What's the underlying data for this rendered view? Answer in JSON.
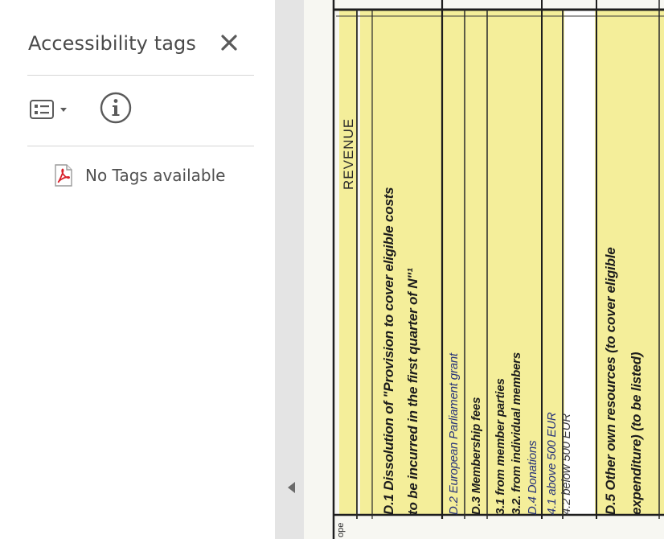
{
  "tags_panel": {
    "title": "Accessibility tags",
    "close_icon": "close-icon",
    "options_icon": "list-options-icon",
    "info_icon": "info-icon",
    "empty_message": "No Tags available",
    "empty_icon": "pdf-file-icon"
  },
  "splitter": {
    "collapse_icon": "triangle-left-icon"
  },
  "document": {
    "header": "REVENUE",
    "rows": [
      {
        "id": "d1-line1",
        "text": "D.1 Dissolution of \"Provision to cover eligible costs"
      },
      {
        "id": "d1-line2",
        "text": "to be incurred in the first quarter of N\"¹"
      },
      {
        "id": "d2",
        "text": "D.2 European Parliament grant"
      },
      {
        "id": "d3",
        "text": "D.3 Membership fees"
      },
      {
        "id": "d31",
        "text": "3.1 from member parties"
      },
      {
        "id": "d32",
        "text": "3.2. from individual members"
      },
      {
        "id": "d4",
        "text": "D.4 Donations"
      },
      {
        "id": "d41",
        "text": "4.1 above 500 EUR"
      },
      {
        "id": "d42",
        "text": "4.2 below 500 EUR"
      },
      {
        "id": "d5-line1",
        "text": "D.5 Other own resources (to cover eligible"
      },
      {
        "id": "d5-line2",
        "text": "expenditure) (to be listed)"
      }
    ],
    "footer_fragment": "ope"
  },
  "colors": {
    "panel_bg": "#ffffff",
    "splitter_bg": "#e4e4e4",
    "row_yellow": "#f4ee9a",
    "ink": "#1c1c1c",
    "link_blue": "#27337a"
  }
}
